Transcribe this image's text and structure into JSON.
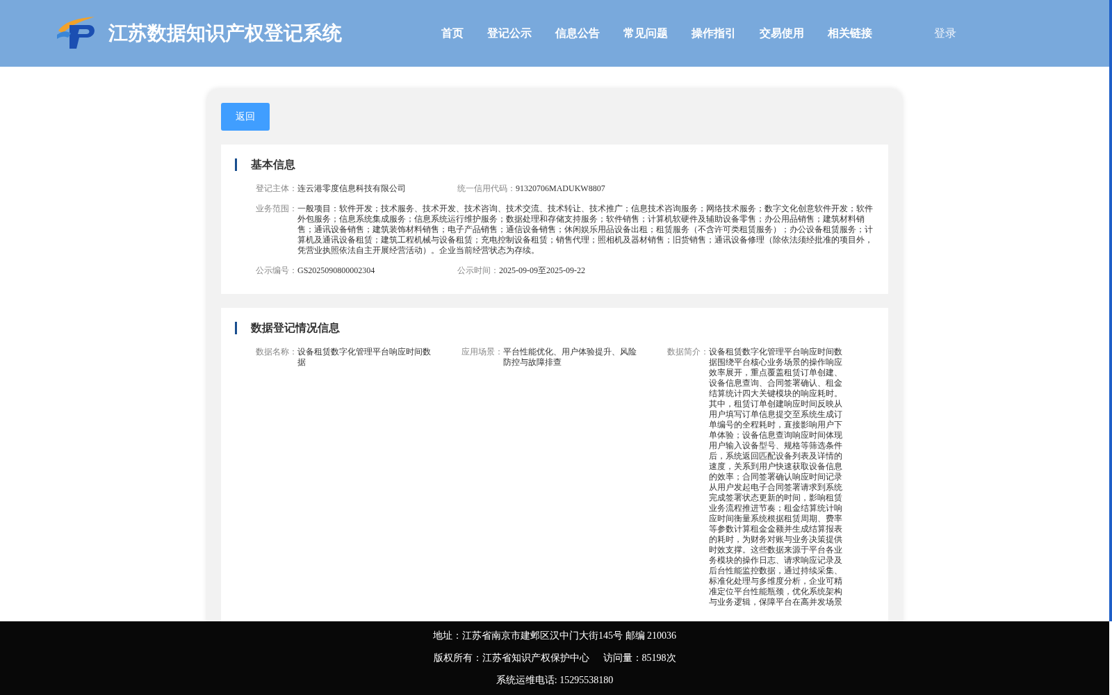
{
  "header": {
    "title": "江苏数据知识产权登记系统",
    "nav": [
      "首页",
      "登记公示",
      "信息公告",
      "常见问题",
      "操作指引",
      "交易使用",
      "相关链接"
    ],
    "login": "登录"
  },
  "back_button": "返回",
  "basic_info": {
    "title": "基本信息",
    "rows": [
      {
        "kind": "pair",
        "fields": [
          {
            "label": "登记主体：",
            "value": "连云港零度信息科技有限公司"
          },
          {
            "label": "统一信用代码：",
            "value": "91320706MADUKW8807"
          }
        ]
      },
      {
        "kind": "full",
        "fields": [
          {
            "label": "业务范围：",
            "value": "一般项目：软件开发；技术服务、技术开发、技术咨询、技术交流、技术转让、技术推广；信息技术咨询服务；网络技术服务；数字文化创意软件开发；软件外包服务；信息系统集成服务；信息系统运行维护服务；数据处理和存储支持服务；软件销售；计算机软硬件及辅助设备零售；办公用品销售；建筑材料销售；通讯设备销售；建筑装饰材料销售；电子产品销售；通信设备销售；休闲娱乐用品设备出租；租赁服务（不含许可类租赁服务）；办公设备租赁服务；计算机及通讯设备租赁；建筑工程机械与设备租赁；充电控制设备租赁；销售代理；照相机及器材销售；旧货销售；通讯设备修理（除依法须经批准的项目外，凭营业执照依法自主开展经营活动）。企业当前经营状态为存续。"
          }
        ]
      },
      {
        "kind": "pair",
        "fields": [
          {
            "label": "公示编号：",
            "value": "GS2025090800002304"
          },
          {
            "label": "公示时间：",
            "value": "2025-09-09至2025-09-22"
          }
        ]
      }
    ]
  },
  "data_info": {
    "title": "数据登记情况信息",
    "fields": [
      {
        "label": "数据名称：",
        "value": "设备租赁数字化管理平台响应时间数据"
      },
      {
        "label": "应用场景：",
        "value": "平台性能优化、用户体验提升、风险防控与故障排查"
      },
      {
        "label": "数据简介：",
        "value": "设备租赁数字化管理平台响应时间数据围绕平台核心业务场景的操作响应效率展开，重点覆盖租赁订单创建、设备信息查询、合同签署确认、租金结算统计四大关键模块的响应耗时。其中，租赁订单创建响应时间反映从用户填写订单信息提交至系统生成订单编号的全程耗时，直接影响用户下单体验；设备信息查询响应时间体现用户输入设备型号、规格等筛选条件后，系统返回匹配设备列表及详情的速度，关系到用户快速获取设备信息的效率；合同签署确认响应时间记录从用户发起电子合同签署请求到系统完成签署状态更新的时间，影响租赁业务流程推进节奏；租金结算统计响应时间衡量系统根据租赁周期、费率等参数计算租金金额并生成结算报表的耗时，为财务对账与业务决策提供时效支撑。这些数据来源于平台各业务模块的操作日志、请求响应记录及后台性能监控数据，通过持续采集、标准化处理与多维度分析，企业可精准定位平台性能瓶颈，优化系统架构与业务逻辑，保障平台在高并发场景"
      }
    ]
  },
  "footer": {
    "address": "地址：江苏省南京市建邺区汉中门大街145号 邮编 210036",
    "copyright": "版权所有：江苏省知识产权保护中心",
    "visits": "访问量：85198次",
    "phone": "系统运维电话: 15295538180"
  }
}
